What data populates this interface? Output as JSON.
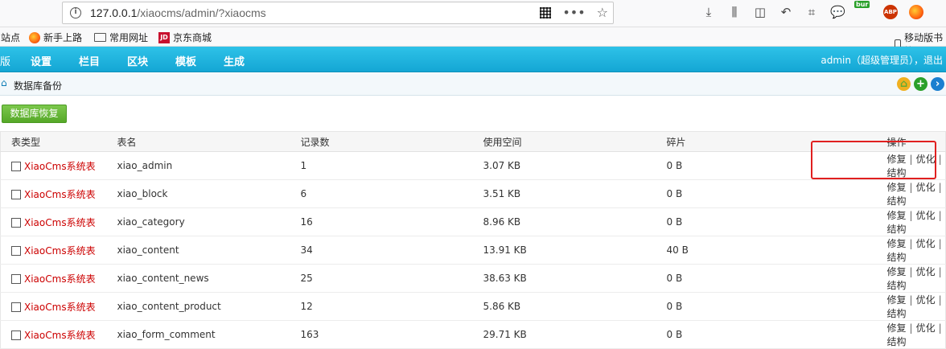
{
  "browser": {
    "url_host": "127.0.0.1",
    "url_path": "/xiaocms/admin/?xiaocms",
    "bur_badge": "bur",
    "abp_label": "ABP"
  },
  "bookmarks": {
    "item0": "站点",
    "item1": "新手上路",
    "item2": "常用网址",
    "item3": "京东商城",
    "jd_logo": "JD",
    "mobile": "移动版书签"
  },
  "header": {
    "nav": [
      "版",
      "设置",
      "栏目",
      "区块",
      "模板",
      "生成"
    ],
    "user": "admin（超级管理员），退出"
  },
  "subbar": {
    "title": "数据库备份"
  },
  "actions": {
    "restore": "数据库恢复"
  },
  "table": {
    "headers": [
      "表类型",
      "表名",
      "记录数",
      "使用空间",
      "碎片",
      "操作"
    ],
    "ops": [
      "修复",
      "优化",
      "结构"
    ],
    "separator": "|",
    "rows": [
      {
        "type": "XiaoCms系统表",
        "name": "xiao_admin",
        "records": "1",
        "size": "3.07 KB",
        "frag": "0 B"
      },
      {
        "type": "XiaoCms系统表",
        "name": "xiao_block",
        "records": "6",
        "size": "3.51 KB",
        "frag": "0 B"
      },
      {
        "type": "XiaoCms系统表",
        "name": "xiao_category",
        "records": "16",
        "size": "8.96 KB",
        "frag": "0 B"
      },
      {
        "type": "XiaoCms系统表",
        "name": "xiao_content",
        "records": "34",
        "size": "13.91 KB",
        "frag": "40 B"
      },
      {
        "type": "XiaoCms系统表",
        "name": "xiao_content_news",
        "records": "25",
        "size": "38.63 KB",
        "frag": "0 B"
      },
      {
        "type": "XiaoCms系统表",
        "name": "xiao_content_product",
        "records": "12",
        "size": "5.86 KB",
        "frag": "0 B"
      },
      {
        "type": "XiaoCms系统表",
        "name": "xiao_form_comment",
        "records": "163",
        "size": "29.71 KB",
        "frag": "0 B"
      }
    ]
  }
}
